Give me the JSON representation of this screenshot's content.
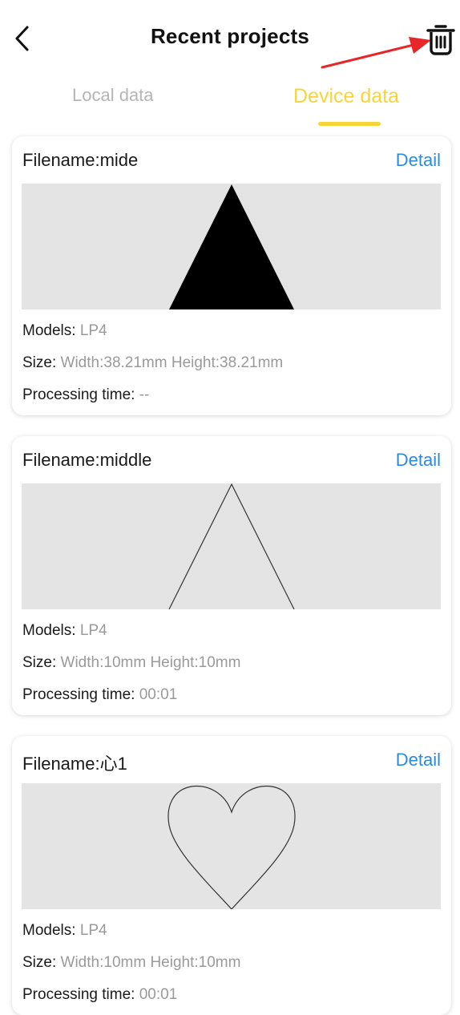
{
  "header": {
    "title": "Recent projects",
    "back_icon": "chevron-left-icon",
    "delete_icon": "trash-icon",
    "annotation_color": "#e8262a"
  },
  "tabs": [
    {
      "label": "Local data",
      "active": false
    },
    {
      "label": "Device data",
      "active": true
    }
  ],
  "colors": {
    "accent": "#f6d53a",
    "link": "#2a8be0",
    "muted": "#9a9a9a"
  },
  "projects": [
    {
      "filename": "Filename:mide",
      "detail_label": "Detail",
      "preview_shape": "filled-triangle",
      "models_label": "Models:",
      "models_value": "LP4",
      "size_label": "Size:",
      "size_value": "Width:38.21mm Height:38.21mm",
      "time_label": "Processing time:",
      "time_value": "--"
    },
    {
      "filename": "Filename:middle",
      "detail_label": "Detail",
      "preview_shape": "outline-triangle",
      "models_label": "Models:",
      "models_value": "LP4",
      "size_label": "Size:",
      "size_value": "Width:10mm Height:10mm",
      "time_label": "Processing time:",
      "time_value": "00:01"
    },
    {
      "filename": "Filename:心1",
      "detail_label": "Detail",
      "preview_shape": "outline-heart",
      "models_label": "Models:",
      "models_value": "LP4",
      "size_label": "Size:",
      "size_value": "Width:10mm Height:10mm",
      "time_label": "Processing time:",
      "time_value": "00:01"
    }
  ]
}
